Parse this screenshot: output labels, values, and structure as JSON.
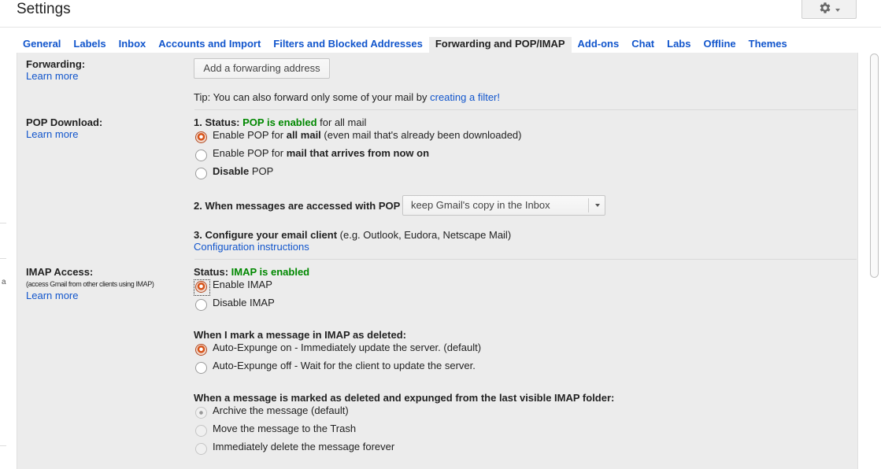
{
  "page": {
    "title": "Settings"
  },
  "icons": {
    "settings": "gear-icon",
    "dropdown": "chevron-down-icon"
  },
  "colors": {
    "link": "#1155cc",
    "enabled_green": "#008800",
    "panel_bg": "#ececec",
    "radio_selected": "#d8541a"
  },
  "tabs": [
    {
      "label": "General"
    },
    {
      "label": "Labels"
    },
    {
      "label": "Inbox"
    },
    {
      "label": "Accounts and Import"
    },
    {
      "label": "Filters and Blocked Addresses"
    },
    {
      "label": "Forwarding and POP/IMAP",
      "active": true
    },
    {
      "label": "Add-ons"
    },
    {
      "label": "Chat"
    },
    {
      "label": "Labs"
    },
    {
      "label": "Offline"
    },
    {
      "label": "Themes"
    }
  ],
  "forwarding": {
    "label": "Forwarding:",
    "learn_more": "Learn more",
    "add_button": "Add a forwarding address",
    "tip_prefix": "Tip: You can also forward only some of your mail by ",
    "tip_link": "creating a filter!"
  },
  "pop": {
    "label": "POP Download:",
    "learn_more": "Learn more",
    "status_prefix": "1. Status: ",
    "status_value": "POP is enabled",
    "status_suffix": " for all mail",
    "options": [
      {
        "pre": "Enable POP for ",
        "bold": "all mail",
        "post": " (even mail that's already been downloaded)",
        "selected": true
      },
      {
        "pre": "Enable POP for ",
        "bold": "mail that arrives from now on",
        "post": "",
        "selected": false
      },
      {
        "pre": "",
        "bold": "Disable",
        "post": " POP",
        "selected": false
      }
    ],
    "access_label": "2. When messages are accessed with POP",
    "access_value": "keep Gmail's copy in the Inbox",
    "configure_label": "3. Configure your email client",
    "configure_hint": " (e.g. Outlook, Eudora, Netscape Mail)",
    "configure_link": "Configuration instructions"
  },
  "imap": {
    "label": "IMAP Access:",
    "sublabel": "(access Gmail from other clients using IMAP)",
    "learn_more": "Learn more",
    "status_prefix": "Status: ",
    "status_value": "IMAP is enabled",
    "options": [
      {
        "label": "Enable IMAP",
        "selected": true
      },
      {
        "label": "Disable IMAP",
        "selected": false
      }
    ],
    "deleted_heading": "When I mark a message in IMAP as deleted:",
    "deleted_options": [
      {
        "label": "Auto-Expunge on - Immediately update the server. (default)",
        "selected": true
      },
      {
        "label": "Auto-Expunge off - Wait for the client to update the server.",
        "selected": false
      }
    ],
    "expunged_heading": "When a message is marked as deleted and expunged from the last visible IMAP folder:",
    "expunged_options": [
      {
        "label": "Archive the message (default)",
        "selected": true,
        "disabled": true
      },
      {
        "label": "Move the message to the Trash",
        "selected": false,
        "disabled": true
      },
      {
        "label": "Immediately delete the message forever",
        "selected": false,
        "disabled": true
      }
    ]
  },
  "left_edge_glyph": "a"
}
